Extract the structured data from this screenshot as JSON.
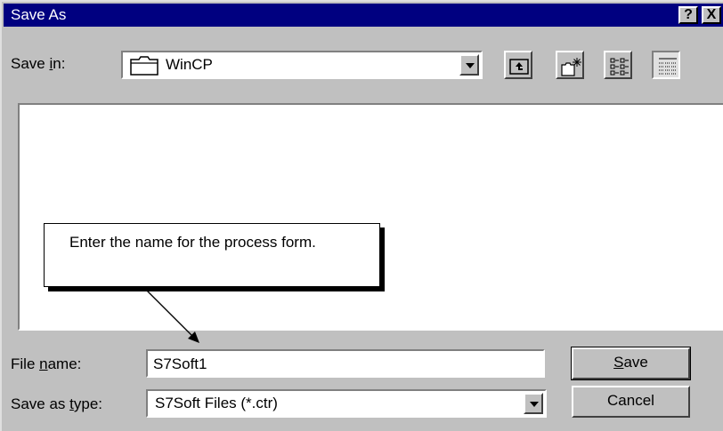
{
  "dialog": {
    "title": "Save As",
    "help_button": "?",
    "close_button": "X"
  },
  "save_in": {
    "label_prefix": "Save ",
    "label_hotkey": "i",
    "label_suffix": "n:",
    "value": "WinCP"
  },
  "toolbar": {
    "up_folder_icon": "up-one-level-icon",
    "new_folder_icon": "create-new-folder-icon",
    "list_view_icon": "list-view-icon",
    "details_view_icon": "details-view-icon"
  },
  "callout": {
    "text": "Enter the name for the process form."
  },
  "file_name": {
    "label_prefix": "File ",
    "label_hotkey": "n",
    "label_suffix": "ame:",
    "value": "S7Soft1"
  },
  "save_as_type": {
    "label_prefix": "Save as ",
    "label_hotkey": "t",
    "label_suffix": "ype:",
    "value": "S7Soft Files (*.ctr)"
  },
  "buttons": {
    "save_hotkey": "S",
    "save_rest": "ave",
    "cancel": "Cancel"
  }
}
